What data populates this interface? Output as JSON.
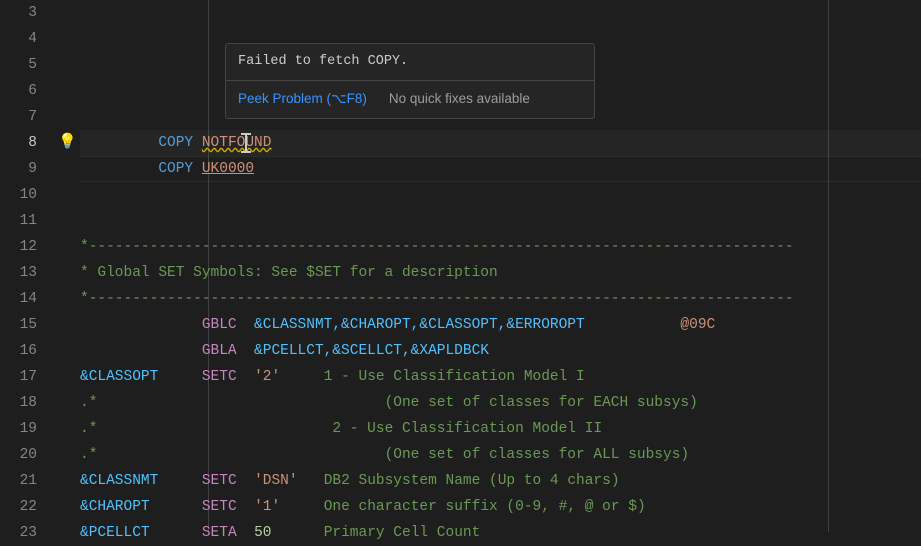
{
  "lineStart": 3,
  "activeLine": 8,
  "hover": {
    "message": "Failed to fetch COPY.",
    "peekLabel": "Peek Problem (⌥F8)",
    "noFixLabel": "No quick fixes available"
  },
  "glyphs": {
    "lightbulbLine": 8,
    "lightbulbChar": "💡"
  },
  "lines": {
    "3": [],
    "4": [],
    "5": [],
    "6": [],
    "7": [],
    "8": [
      {
        "t": "         ",
        "c": ""
      },
      {
        "t": "COPY",
        "c": "keyword"
      },
      {
        "t": " ",
        "c": ""
      },
      {
        "t": "NOTFOUND",
        "c": "operand squiggle"
      }
    ],
    "9": [
      {
        "t": "         ",
        "c": ""
      },
      {
        "t": "COPY",
        "c": "keyword"
      },
      {
        "t": " ",
        "c": ""
      },
      {
        "t": "UK0000",
        "c": "operand-underline"
      }
    ],
    "10": [],
    "11": [],
    "12": [
      {
        "t": "*---------------------------------------------------------------------------------",
        "c": "comment"
      }
    ],
    "13": [
      {
        "t": "* Global SET Symbols: See $SET for a description",
        "c": "comment"
      }
    ],
    "14": [
      {
        "t": "*---------------------------------------------------------------------------------",
        "c": "comment"
      }
    ],
    "15": [
      {
        "t": "              ",
        "c": ""
      },
      {
        "t": "GBLC",
        "c": "opcode"
      },
      {
        "t": "  ",
        "c": ""
      },
      {
        "t": "&CLASSNMT,&CHAROPT,&CLASSOPT,&ERROROPT",
        "c": "variable"
      },
      {
        "t": "           ",
        "c": ""
      },
      {
        "t": "@09C",
        "c": "tag"
      }
    ],
    "16": [
      {
        "t": "              ",
        "c": ""
      },
      {
        "t": "GBLA",
        "c": "opcode"
      },
      {
        "t": "  ",
        "c": ""
      },
      {
        "t": "&PCELLCT,&SCELLCT,&XAPLDBCK",
        "c": "variable"
      }
    ],
    "17": [
      {
        "t": "&CLASSOPT",
        "c": "variable"
      },
      {
        "t": "     ",
        "c": ""
      },
      {
        "t": "SETC",
        "c": "opcode"
      },
      {
        "t": "  ",
        "c": ""
      },
      {
        "t": "'2'",
        "c": "string"
      },
      {
        "t": "     ",
        "c": ""
      },
      {
        "t": "1 - Use Classification Model I",
        "c": "comment"
      }
    ],
    "18": [
      {
        "t": ".*",
        "c": "comment"
      },
      {
        "t": "                                 ",
        "c": ""
      },
      {
        "t": "(One set of classes for EACH subsys)",
        "c": "comment"
      }
    ],
    "19": [
      {
        "t": ".*",
        "c": "comment"
      },
      {
        "t": "                           ",
        "c": ""
      },
      {
        "t": "2 - Use Classification Model II",
        "c": "comment"
      }
    ],
    "20": [
      {
        "t": ".*",
        "c": "comment"
      },
      {
        "t": "                                 ",
        "c": ""
      },
      {
        "t": "(One set of classes for ALL subsys)",
        "c": "comment"
      }
    ],
    "21": [
      {
        "t": "&CLASSNMT",
        "c": "variable"
      },
      {
        "t": "     ",
        "c": ""
      },
      {
        "t": "SETC",
        "c": "opcode"
      },
      {
        "t": "  ",
        "c": ""
      },
      {
        "t": "'DSN'",
        "c": "string"
      },
      {
        "t": "   ",
        "c": ""
      },
      {
        "t": "DB2 Subsystem Name (Up to 4 chars)",
        "c": "comment"
      }
    ],
    "22": [
      {
        "t": "&CHAROPT",
        "c": "variable"
      },
      {
        "t": "      ",
        "c": ""
      },
      {
        "t": "SETC",
        "c": "opcode"
      },
      {
        "t": "  ",
        "c": ""
      },
      {
        "t": "'1'",
        "c": "string"
      },
      {
        "t": "     ",
        "c": ""
      },
      {
        "t": "One character suffix (0-9, #, @ or $)",
        "c": "comment"
      }
    ],
    "23": [
      {
        "t": "&PCELLCT",
        "c": "variable"
      },
      {
        "t": "      ",
        "c": ""
      },
      {
        "t": "SETA",
        "c": "opcode"
      },
      {
        "t": "  ",
        "c": ""
      },
      {
        "t": "50",
        "c": "number"
      },
      {
        "t": "      ",
        "c": ""
      },
      {
        "t": "Primary Cell Count",
        "c": "comment"
      }
    ]
  }
}
